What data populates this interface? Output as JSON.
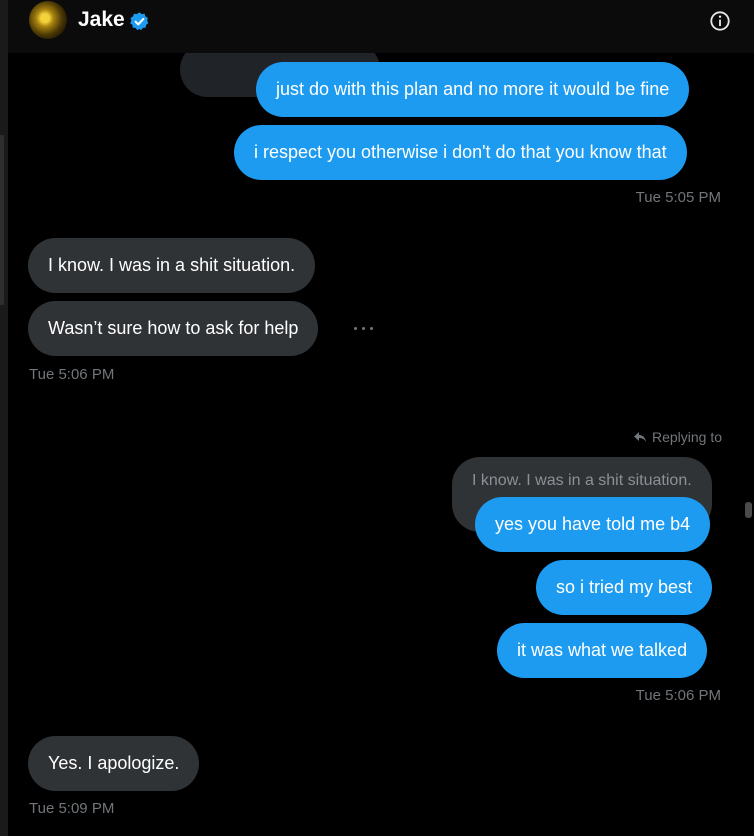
{
  "header": {
    "contact_name": "Jake",
    "avatar_icon": "avatar-photo",
    "verified_icon": "verified-badge-icon",
    "info_icon": "info-icon"
  },
  "colors": {
    "outgoing": "#1d9bf0",
    "incoming": "#2f3336",
    "background": "#000000",
    "muted": "#71767b"
  },
  "messages": {
    "m1": "just do with this plan and no more it would be fine",
    "m2": "i respect you otherwise i don't do that you know that",
    "ts1": "Tue 5:05 PM",
    "m3": "I know. I was in a shit situation.",
    "m4": "Wasn’t sure how to ask for help",
    "ts2": "Tue 5:06 PM",
    "replying_to": "Replying to",
    "quoted": "I know. I was in a shit situation.",
    "m5": "yes you have told me b4",
    "m6": "so i tried my best",
    "m7": "it was what we talked",
    "ts3": "Tue 5:06 PM",
    "m8": "Yes. I apologize.",
    "ts4": "Tue 5:09 PM"
  }
}
